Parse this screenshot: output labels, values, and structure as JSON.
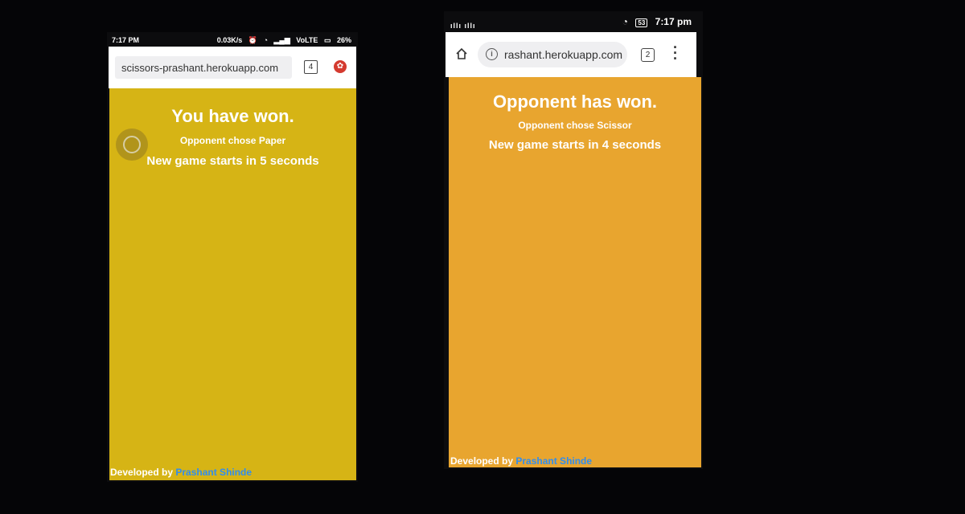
{
  "left_phone": {
    "status_bar": {
      "time": "7:17 PM",
      "net_speed": "0.03K/s",
      "network": "VoLTE",
      "battery": "26%"
    },
    "browser": {
      "url": "scissors-prashant.herokuapp.com",
      "tab_count": "4"
    },
    "page": {
      "result": "You have won.",
      "opponent_choice": "Opponent chose Paper",
      "countdown": "New game starts in 5 seconds",
      "footer_prefix": "Developed by",
      "footer_author": "Prashant Shinde",
      "background_color": "#d6b415"
    }
  },
  "right_phone": {
    "status_bar": {
      "time": "7:17 pm",
      "battery_level": "53"
    },
    "browser": {
      "url": "rashant.herokuapp.com",
      "tab_count": "2"
    },
    "page": {
      "result": "Opponent has won.",
      "opponent_choice": "Opponent chose Scissor",
      "countdown": "New game starts in 4 seconds",
      "footer_prefix": "Developed by",
      "footer_author": "Prashant Shinde",
      "background_color": "#e8a52f"
    }
  },
  "colors": {
    "link": "#2f8df0",
    "extension_icon": "#d43a2f",
    "backdrop": "#050507"
  },
  "icons": {
    "left": [
      "alarm-icon",
      "wifi-icon",
      "signal-icon",
      "battery-icon",
      "tab-switcher-icon",
      "extension-icon"
    ],
    "right": [
      "signal-icon",
      "wifi-icon",
      "battery-icon",
      "home-icon",
      "info-icon",
      "tab-switcher-icon",
      "menu-icon"
    ]
  }
}
